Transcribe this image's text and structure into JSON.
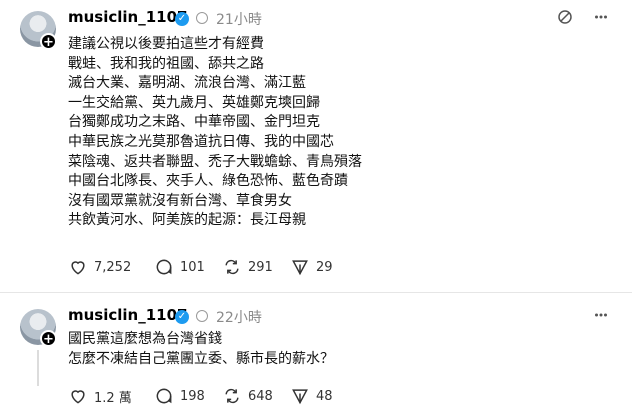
{
  "posts": [
    {
      "username": "musiclin_1107",
      "timestamp": "21小時",
      "lines": [
        "建議公視以後要拍這些才有經費",
        "戰蛙、我和我的祖國、舔共之路",
        "滅台大業、嘉明湖、流浪台灣、滿江藍",
        "一生交給黨、英九歲月、英雄鄭克塽回歸",
        "台獨鄭成功之末路、中華帝國、金門坦克",
        "中華民族之光莫那魯道抗日傳、我的中國芯",
        "菜陰魂、返共者聯盟、禿子大戰蟾蜍、青鳥殞落",
        "中國台北隊長、夾手人、綠色恐怖、藍色奇蹟",
        "沒有國眾黨就沒有新台灣、草食男女",
        "共飲黃河水、阿美族的起源：長江母親"
      ],
      "likes": "7,252",
      "comments": "101",
      "reposts": "291",
      "shares": "29"
    },
    {
      "username": "musiclin_1107",
      "timestamp": "22小時",
      "lines": [
        "國民黨這麼想為台灣省錢",
        "怎麼不凍結自己黨團立委、縣市長的薪水？"
      ],
      "likes": "1.2 萬",
      "comments": "198",
      "reposts": "648",
      "shares": "48"
    }
  ],
  "icons": {
    "verified": "verified-badge-icon",
    "activity": "activity-icon",
    "more": "more-icon",
    "like": "heart-icon",
    "comment": "comment-icon",
    "repost": "repost-icon",
    "share": "share-icon"
  },
  "colors": {
    "verified": "#1d9bf0",
    "text": "#111111",
    "muted": "#8a8a8a"
  }
}
